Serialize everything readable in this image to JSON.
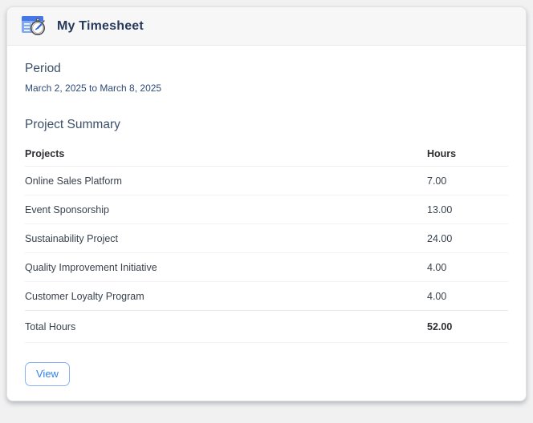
{
  "header": {
    "title": "My Timesheet",
    "icon": "timesheet-calendar-stopwatch-icon"
  },
  "period": {
    "heading": "Period",
    "range": "March 2, 2025 to March 8, 2025"
  },
  "summary": {
    "heading": "Project Summary",
    "columns": {
      "project": "Projects",
      "hours": "Hours"
    },
    "rows": [
      {
        "project": "Online Sales Platform",
        "hours": "7.00"
      },
      {
        "project": "Event Sponsorship",
        "hours": "13.00"
      },
      {
        "project": "Sustainability Project",
        "hours": "24.00"
      },
      {
        "project": "Quality Improvement Initiative",
        "hours": "4.00"
      },
      {
        "project": "Customer Loyalty Program",
        "hours": "4.00"
      }
    ],
    "total": {
      "label": "Total Hours",
      "hours": "52.00"
    }
  },
  "actions": {
    "view_label": "View"
  },
  "colors": {
    "accent": "#2f80ed",
    "button_border": "#8ab0f2",
    "title_text": "#27395a",
    "heading_text": "#3c5068",
    "date_text": "#2d4a78",
    "table_text": "#38424c",
    "card_header_bg": "#f7f7f8",
    "page_bg": "#f1f1f2"
  }
}
